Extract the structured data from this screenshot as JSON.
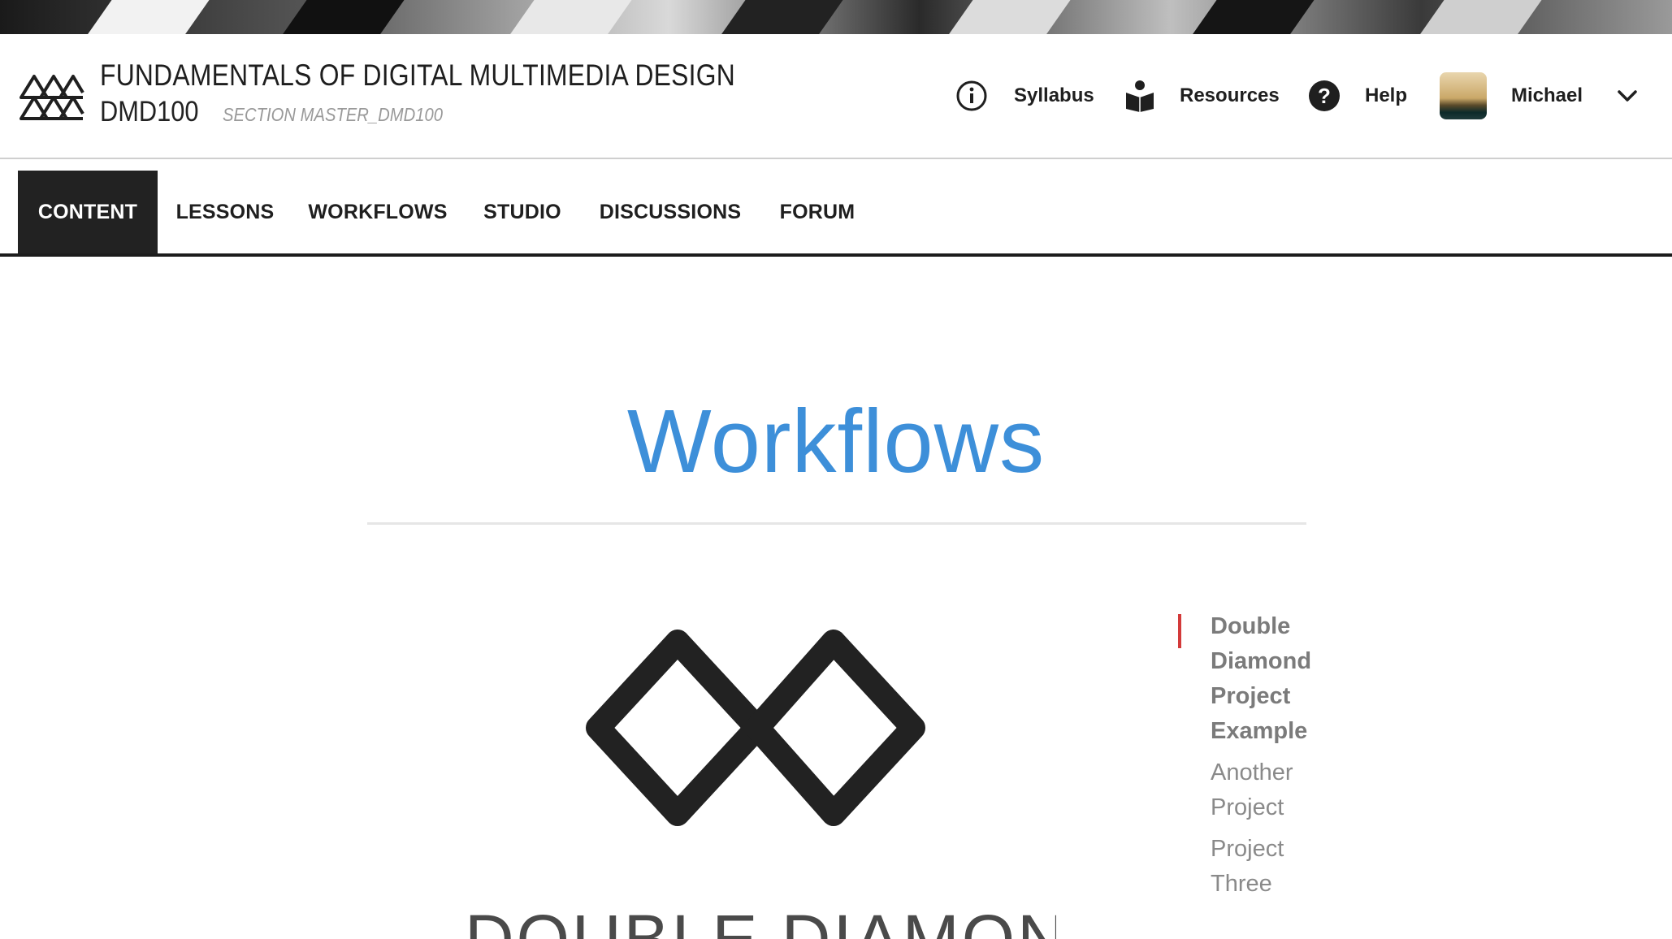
{
  "course": {
    "title": "FUNDAMENTALS OF DIGITAL MULTIMEDIA DESIGN",
    "code": "DMD100",
    "section": "SECTION MASTER_DMD100"
  },
  "header_nav": {
    "syllabus": "Syllabus",
    "resources": "Resources",
    "help": "Help",
    "user_name": "Michael"
  },
  "tabs": [
    {
      "label": "CONTENT",
      "active": true
    },
    {
      "label": "LESSONS",
      "active": false
    },
    {
      "label": "WORKFLOWS",
      "active": false
    },
    {
      "label": "STUDIO",
      "active": false
    },
    {
      "label": "DISCUSSIONS",
      "active": false
    },
    {
      "label": "FORUM",
      "active": false
    }
  ],
  "main": {
    "page_title": "Workflows",
    "section_heading": "DOUBLE DIAMOND"
  },
  "toc": [
    {
      "label": "Double Diamond Project Example",
      "active": true
    },
    {
      "label": "Another Project",
      "active": false
    },
    {
      "label": "Project Three",
      "active": false
    }
  ],
  "colors": {
    "accent_blue": "#3d8fd9",
    "active_tab_bg": "#222222",
    "toc_marker": "#d33a3a"
  },
  "icons": {
    "logo": "triangle-grid-logo-icon",
    "syllabus": "info-circle-icon",
    "resources": "book-reader-icon",
    "help": "question-circle-icon",
    "user_menu": "chevron-down-icon",
    "illustration": "double-diamond-icon"
  }
}
